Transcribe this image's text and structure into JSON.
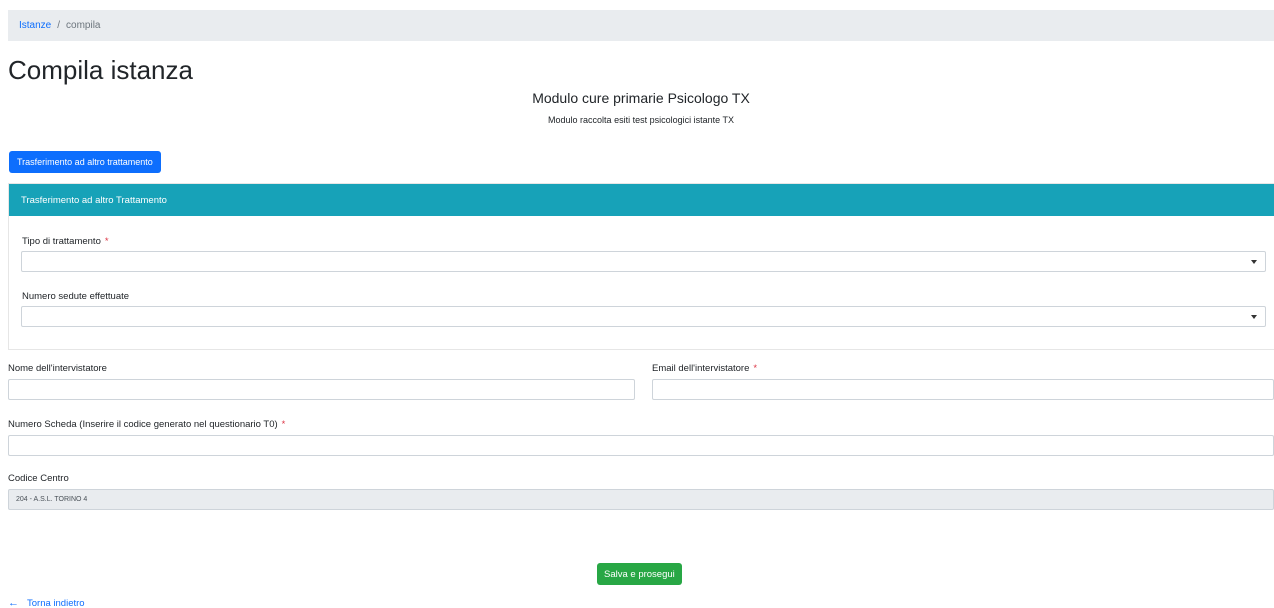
{
  "breadcrumb": {
    "link": "Istanze",
    "separator": "/",
    "current": "compila"
  },
  "page": {
    "title": "Compila istanza"
  },
  "form": {
    "title": "Modulo cure primarie Psicologo TX",
    "subtitle": "Modulo raccolta esiti test psicologici istante TX"
  },
  "transfer_button": "Trasferimento ad altro trattamento",
  "section": {
    "header": "Trasferimento ad altro Trattamento",
    "treatment_type_label": "Tipo di trattamento",
    "treatment_type_value": "",
    "sessions_label": "Numero sedute effettuate",
    "sessions_value": ""
  },
  "fields": {
    "interviewer_name_label": "Nome dell'intervistatore",
    "interviewer_name_value": "",
    "interviewer_email_label": "Email dell'intervistatore",
    "interviewer_email_value": "",
    "card_number_label": "Numero Scheda (Inserire il codice generato nel questionario T0)",
    "card_number_value": "",
    "center_code_label": "Codice Centro",
    "center_code_value": "204 - A.S.L. TORINO 4"
  },
  "required_marker": "*",
  "save_button": "Salva e prosegui",
  "back_link": {
    "arrow": "←",
    "label": "Torna indietro"
  },
  "colors": {
    "primary": "#0d6efd",
    "section_header": "#17a2b8",
    "success": "#28a745",
    "required": "#dc3545",
    "breadcrumb_bg": "#e9ecef"
  }
}
